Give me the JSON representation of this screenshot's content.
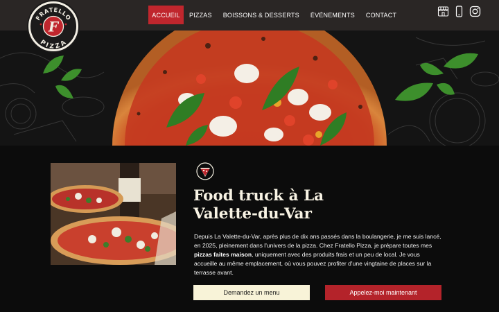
{
  "header": {
    "logo": {
      "top_text": "FRATELLO",
      "letter": "F",
      "bottom_text": "PIZZA"
    },
    "nav": [
      {
        "label": "ACCUEIL",
        "active": true
      },
      {
        "label": "PIZZAS",
        "active": false
      },
      {
        "label": "BOISSONS & DESSERTS",
        "active": false
      },
      {
        "label": "ÉVÉNEMENTS",
        "active": false
      },
      {
        "label": "CONTACT",
        "active": false
      }
    ],
    "icons": [
      "storefront-icon",
      "phone-icon",
      "instagram-icon"
    ]
  },
  "main": {
    "title_line1": "Food truck à La",
    "title_line2": "Valette-du-Var",
    "desc_part1": "Depuis La Valette-du-Var, après plus de dix ans passés dans la boulangerie, je me suis lancé, en 2025, pleinement dans l'univers de la pizza. Chez Fratello Pizza, je prépare toutes mes ",
    "desc_bold": "pizzas faites maison",
    "desc_part2": ", uniquement avec des produits frais et un peu de local. Je vous accueille au même emplacement, où vous pouvez profiter d'une vingtaine de places sur la terrasse avant.",
    "buttons": {
      "menu": "Demandez un menu",
      "call": "Appelez-moi maintenant"
    }
  },
  "colors": {
    "accent_red": "#c0262d",
    "cream": "#f8f3d8",
    "header_bg": "#2a2625",
    "page_bg": "#0c0c0c"
  }
}
